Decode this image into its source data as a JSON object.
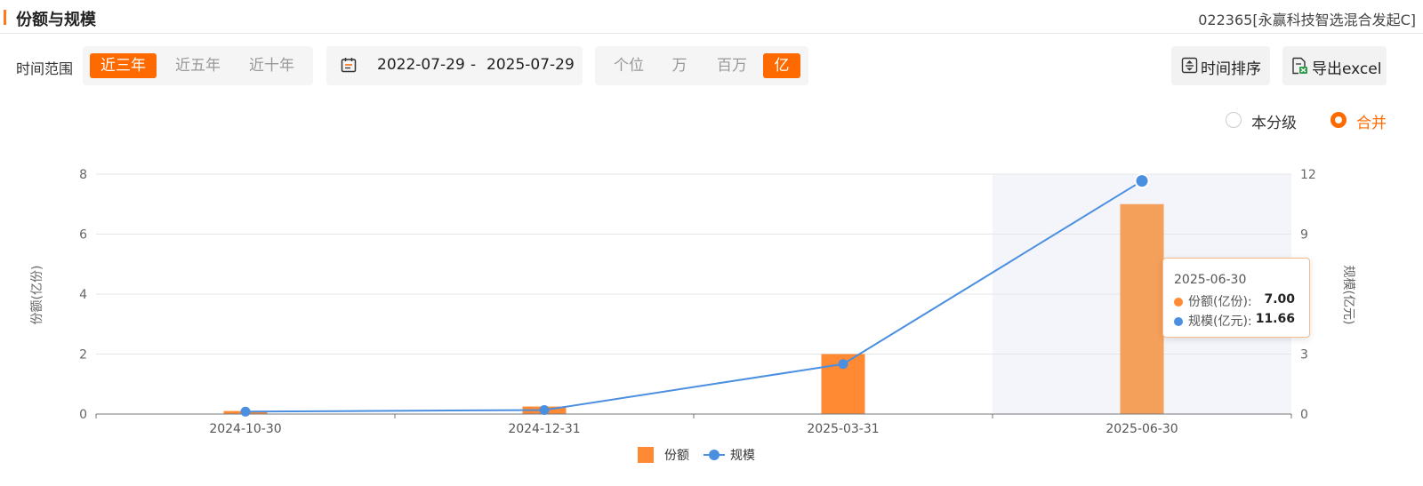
{
  "header": {
    "title": "份额与规模",
    "fund": "022365[永赢科技智选混合发起C]"
  },
  "toolbar": {
    "range_label": "时间范围",
    "ranges": [
      "近三年",
      "近五年",
      "近十年"
    ],
    "range_active": 0,
    "date_start": "2022-07-29",
    "date_sep": "-",
    "date_end": "2025-07-29",
    "units": [
      "个位",
      "万",
      "百万",
      "亿"
    ],
    "unit_active": 3,
    "sort_label": "时间排序",
    "export_label": "导出excel"
  },
  "radios": {
    "level": "本分级",
    "merge": "合并",
    "selected": "merge"
  },
  "colors": {
    "accent": "#ff6a00",
    "bar": "#ff8a33",
    "bar_highlight": "#f5a05a",
    "line": "#4a8fe0"
  },
  "chart_data": {
    "type": "bar",
    "categories": [
      "2024-10-30",
      "2024-12-31",
      "2025-03-31",
      "2025-06-30"
    ],
    "series": [
      {
        "name": "份额",
        "type": "bar",
        "axis": "left",
        "values": [
          0.1,
          0.25,
          2.0,
          7.0
        ]
      },
      {
        "name": "规模",
        "type": "line",
        "axis": "right",
        "values": [
          0.12,
          0.2,
          2.5,
          11.66
        ]
      }
    ],
    "ylabel": "份额(亿份)",
    "ylabel_right": "规模(亿元)",
    "ylim": [
      0,
      8
    ],
    "yticks": [
      "0",
      "2",
      "4",
      "6",
      "8"
    ],
    "ylim_right": [
      0,
      12
    ],
    "yticks_right": [
      "0",
      "3",
      "6",
      "9",
      "12"
    ],
    "grid": true,
    "legend": "bottom-center",
    "highlight_index": 3,
    "tooltip": {
      "date": "2025-06-30",
      "share_label": "份额(亿份):",
      "share_value": "7.00",
      "scale_label": "规模(亿元):",
      "scale_value": "11.66"
    }
  }
}
